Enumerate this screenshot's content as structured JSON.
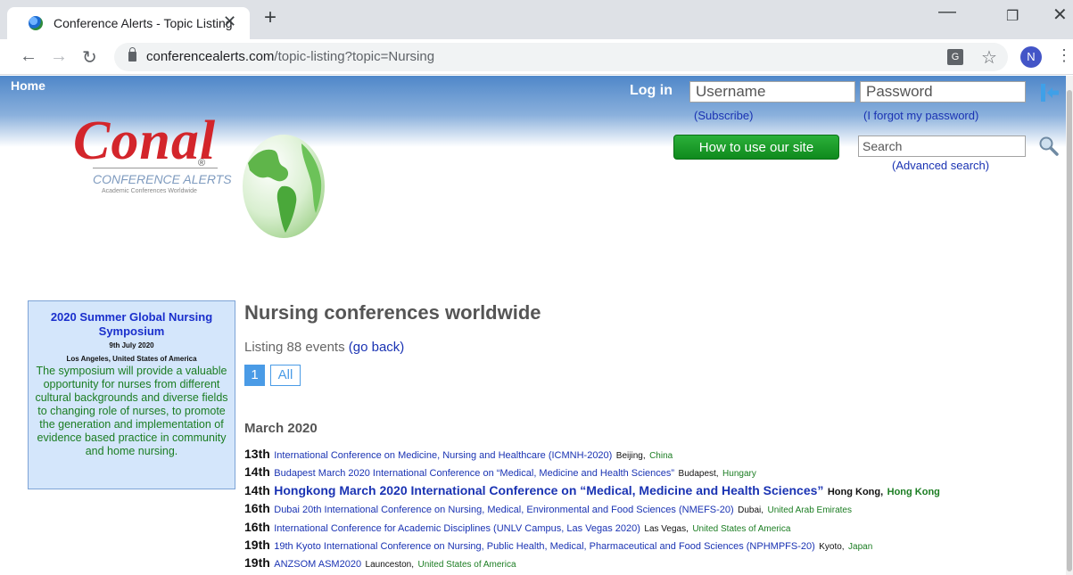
{
  "browser": {
    "tab_title": "Conference Alerts - Topic Listing",
    "tab_close": "✕",
    "new_tab": "+",
    "url_host": "conferencealerts.com",
    "url_path": "/topic-listing?topic=Nursing",
    "profile_initial": "N",
    "translate_glyph": "G"
  },
  "header": {
    "home": "Home",
    "login_label": "Log in",
    "username_placeholder": "Username",
    "password_placeholder": "Password",
    "subscribe": "(Subscribe)",
    "forgot": "(I forgot my password)",
    "howto": "How to use our site",
    "search_placeholder": "Search",
    "advanced_search": "(Advanced search)"
  },
  "logo": {
    "name": "Conal",
    "registered": "®",
    "subtitle": "CONFERENCE ALERTS",
    "tagline": "Academic Conferences Worldwide"
  },
  "ad": {
    "title": "2020 Summer Global Nursing Symposium",
    "date": "9th July 2020",
    "place": "Los Angeles, United States of America",
    "description": "The symposium will provide a valuable opportunity for nurses from different cultural backgrounds and diverse fields to changing role of nurses, to promote the generation and implementation of evidence based practice in community and home nursing."
  },
  "main": {
    "heading": "Nursing conferences worldwide",
    "listing_prefix": "Listing 88 events",
    "go_back": "(go back)",
    "page_current": "1",
    "page_all": "All",
    "month": "March 2020"
  },
  "events": [
    {
      "day": "13th",
      "title": "International Conference on Medicine, Nursing and Healthcare (ICMNH-2020)",
      "city": "Beijing,",
      "country": "China",
      "featured": false
    },
    {
      "day": "14th",
      "title": "Budapest March 2020 International Conference on “Medical, Medicine and Health Sciences”",
      "city": "Budapest,",
      "country": "Hungary",
      "featured": false
    },
    {
      "day": "14th",
      "title": "Hongkong March 2020 International Conference on “Medical, Medicine and Health Sciences”",
      "city": "Hong Kong,",
      "country": "Hong Kong",
      "featured": true
    },
    {
      "day": "16th",
      "title": "Dubai 20th International Conference on Nursing, Medical, Environmental and Food Sciences (NMEFS-20)",
      "city": "Dubai,",
      "country": "United Arab Emirates",
      "featured": false
    },
    {
      "day": "16th",
      "title": "International Conference for Academic Disciplines (UNLV Campus, Las Vegas 2020)",
      "city": "Las Vegas,",
      "country": "United States of America",
      "featured": false
    },
    {
      "day": "19th",
      "title": "19th Kyoto International Conference on Nursing, Public Health, Medical, Pharmaceutical and Food Sciences (NPHMPFS-20)",
      "city": "Kyoto,",
      "country": "Japan",
      "featured": false
    },
    {
      "day": "19th",
      "title": "ANZSOM ASM2020",
      "city": "Launceston,",
      "country": "United States of America",
      "featured": false
    }
  ]
}
